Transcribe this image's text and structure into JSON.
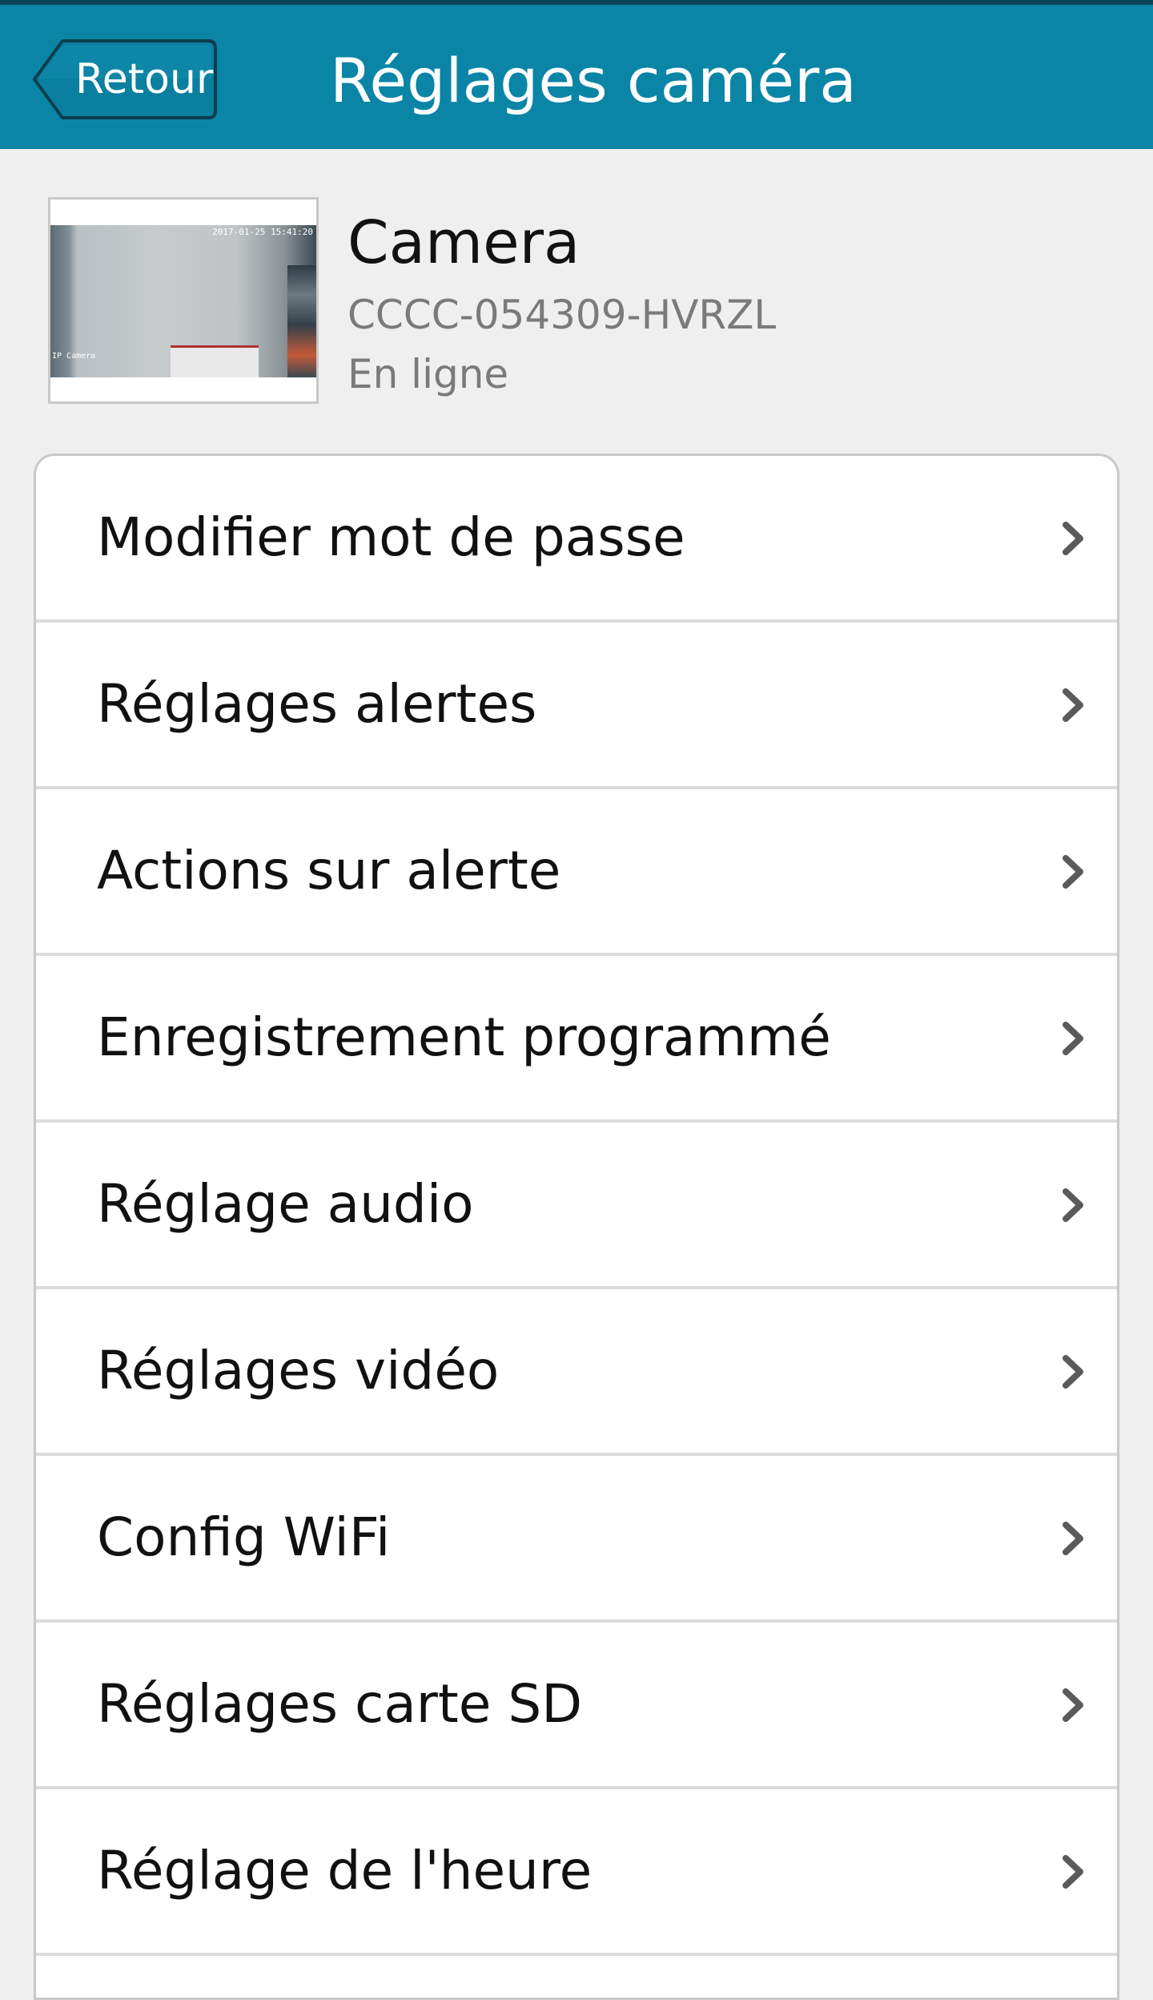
{
  "header": {
    "back_label": "Retour",
    "title": "Réglages caméra",
    "bar_color": "#0a85a6"
  },
  "camera": {
    "name": "Camera",
    "uid": "CCCC-054309-HVRZL",
    "status": "En ligne",
    "thumbnail": {
      "timestamp": "2017-01-25 15:41:20",
      "watermark": "IP Camera"
    }
  },
  "menu": {
    "items": [
      {
        "label": "Modifier mot de passe",
        "icon": "chevron-right-icon"
      },
      {
        "label": "Réglages alertes",
        "icon": "chevron-right-icon"
      },
      {
        "label": "Actions sur alerte",
        "icon": "chevron-right-icon"
      },
      {
        "label": "Enregistrement programmé",
        "icon": "chevron-right-icon"
      },
      {
        "label": "Réglage audio",
        "icon": "chevron-right-icon"
      },
      {
        "label": "Réglages vidéo",
        "icon": "chevron-right-icon"
      },
      {
        "label": "Config WiFi",
        "icon": "chevron-right-icon"
      },
      {
        "label": "Réglages carte SD",
        "icon": "chevron-right-icon"
      },
      {
        "label": "Réglage de l'heure",
        "icon": "chevron-right-icon"
      }
    ]
  }
}
